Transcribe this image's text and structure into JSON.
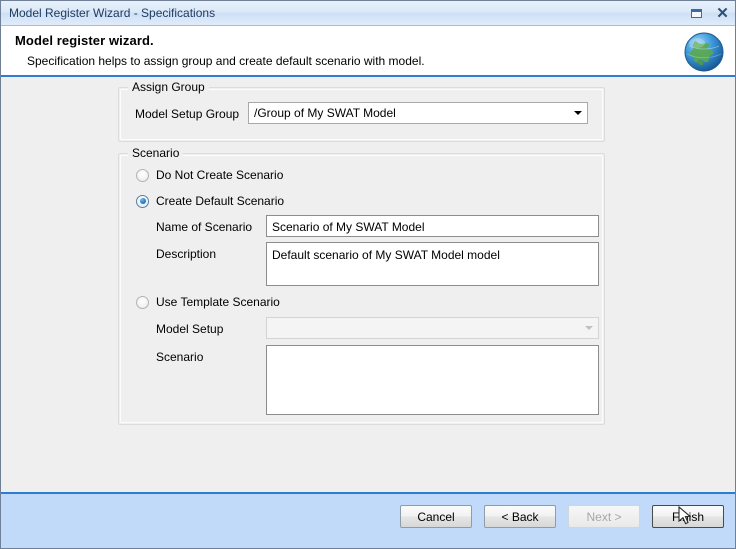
{
  "window": {
    "title": "Model Register Wizard - Specifications",
    "controls": [
      {
        "name": "restore-button",
        "icon": "restore-icon"
      },
      {
        "name": "close-button",
        "icon": "close-icon"
      }
    ]
  },
  "header": {
    "title": "Model register wizard.",
    "subtitle": "Specification helps to assign group and create default scenario with model.",
    "icon": "globe-icon"
  },
  "assign_group": {
    "legend": "Assign Group",
    "model_setup_group": {
      "label": "Model Setup Group",
      "value": "/Group of My SWAT Model",
      "placeholder": ""
    }
  },
  "scenario": {
    "legend": "Scenario",
    "options": [
      {
        "label": "Do Not Create Scenario",
        "selected": false
      },
      {
        "label": "Create Default Scenario",
        "selected": true
      },
      {
        "label": "Use Template Scenario",
        "selected": false
      }
    ],
    "default_scenario": {
      "name_label": "Name of Scenario",
      "name_value": "Scenario of My SWAT Model",
      "name_placeholder": "",
      "description_label": "Description",
      "description_value": "Default scenario of My SWAT Model model",
      "description_placeholder": ""
    },
    "template_scenario": {
      "model_setup_label": "Model Setup",
      "model_setup_value": "",
      "model_setup_placeholder": "",
      "scenario_label": "Scenario",
      "scenario_value": "",
      "scenario_placeholder": ""
    }
  },
  "footer": {
    "buttons": [
      {
        "label": "Cancel",
        "state": "enabled"
      },
      {
        "label": "< Back",
        "state": "enabled"
      },
      {
        "label": "Next >",
        "state": "disabled"
      },
      {
        "label": "Finish",
        "state": "focused"
      }
    ]
  },
  "colors": {
    "accent_blue": "#2d7dd2",
    "footer_blue": "#c2dafa",
    "body_gray": "#efefef",
    "titlebar_blue": "#dbe9f8",
    "radio_dot": "#2a7fc4"
  }
}
